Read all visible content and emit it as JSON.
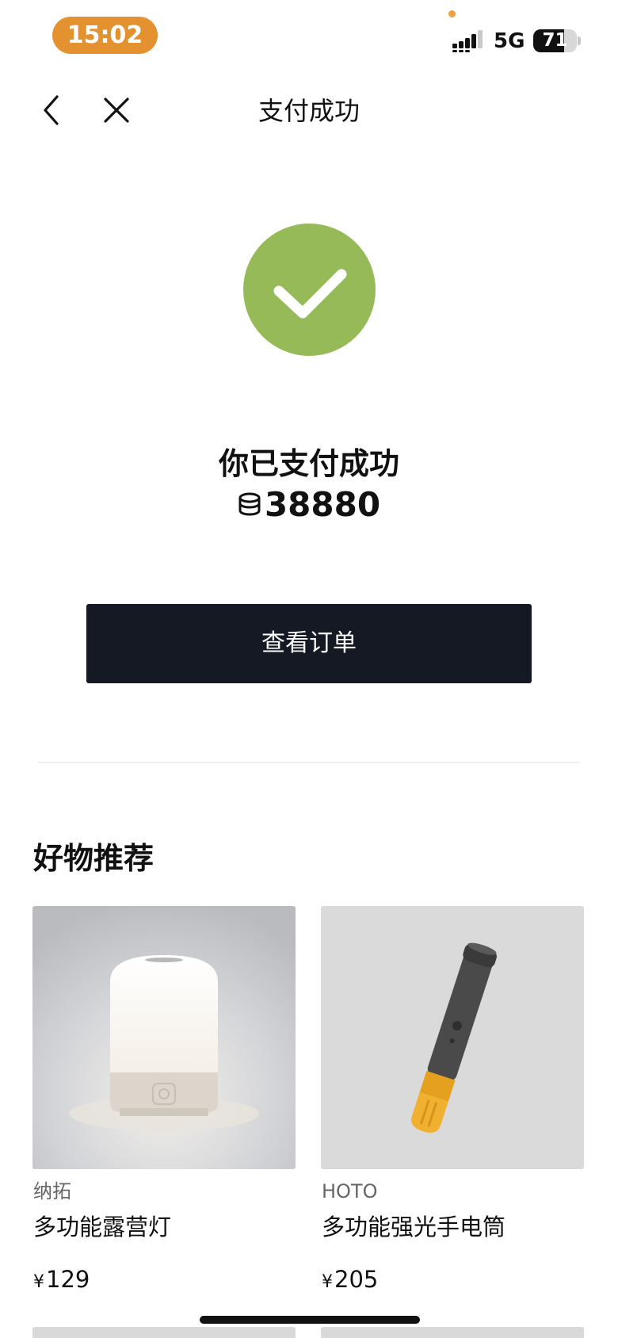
{
  "status_bar": {
    "time": "15:02",
    "network": "5G",
    "battery": "71",
    "battery_level": 0.71,
    "time_pill_color": "#e4922f"
  },
  "nav": {
    "title": "支付成功",
    "back_icon": "chevron-left-icon",
    "close_icon": "close-icon"
  },
  "result": {
    "message": "你已支付成功",
    "amount": "38880",
    "amount_icon": "coin-stack-icon",
    "success_color": "#96ba58"
  },
  "actions": {
    "view_order_label": "查看订单",
    "button_color": "#141924"
  },
  "recommend": {
    "title": "好物推荐",
    "products": [
      {
        "brand": "纳拓",
        "name": "多功能露营灯",
        "currency": "¥",
        "price": "129",
        "image": "camping-lamp"
      },
      {
        "brand": "HOTO",
        "name": "多功能强光手电筒",
        "currency": "¥",
        "price": "205",
        "image": "flashlight"
      }
    ]
  }
}
